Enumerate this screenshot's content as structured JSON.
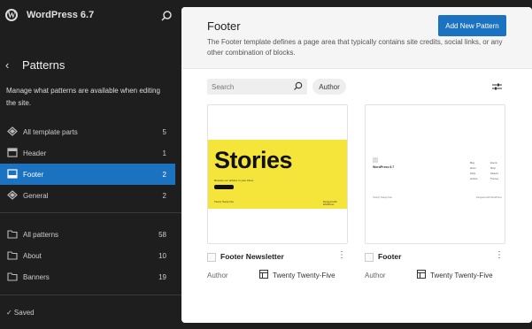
{
  "app": {
    "site_title": "WordPress 6.7"
  },
  "sidebar": {
    "section_title": "Patterns",
    "description": "Manage what patterns are available when editing the site.",
    "template_parts": [
      {
        "label": "All template parts",
        "count": "5",
        "icon": "diamond-icon"
      },
      {
        "label": "Header",
        "count": "1",
        "icon": "header-icon"
      },
      {
        "label": "Footer",
        "count": "2",
        "icon": "footer-icon",
        "active": true
      },
      {
        "label": "General",
        "count": "2",
        "icon": "diamond-icon"
      }
    ],
    "categories": [
      {
        "label": "All patterns",
        "count": "58",
        "icon": "folder-icon"
      },
      {
        "label": "About",
        "count": "10",
        "icon": "folder-icon"
      },
      {
        "label": "Banners",
        "count": "19",
        "icon": "folder-icon"
      }
    ],
    "status": "✓  Saved"
  },
  "main": {
    "title": "Footer",
    "description": "The Footer template defines a page area that typically contains site credits, social links, or any other combination of blocks.",
    "add_button": "Add New Pattern",
    "search_placeholder": "Search",
    "author_filter": "Author",
    "cards": [
      {
        "name": "Footer Newsletter",
        "author_label": "Author",
        "author": "Twenty Twenty-Five",
        "preview": {
          "headline": "Stories",
          "subtitle": "Receive our articles in your inbox.",
          "foot_left": "Twenty Twenty-Five",
          "foot_right": "Designed with WordPress"
        }
      },
      {
        "name": "Footer",
        "author_label": "Author",
        "author": "Twenty Twenty-Five",
        "preview": {
          "site": "WordPress 6.7",
          "col1": [
            "Blog",
            "About",
            "FAQs",
            "Authors"
          ],
          "col2": [
            "Events",
            "Shop",
            "Patterns",
            "Themes"
          ],
          "foot_left": "Twenty Twenty-Five",
          "foot_right": "Designed with WordPress"
        }
      }
    ]
  },
  "colors": {
    "accent": "#1a72c1",
    "sidebar_bg": "#1e1e1e",
    "preview_yellow": "#f5e53a"
  }
}
